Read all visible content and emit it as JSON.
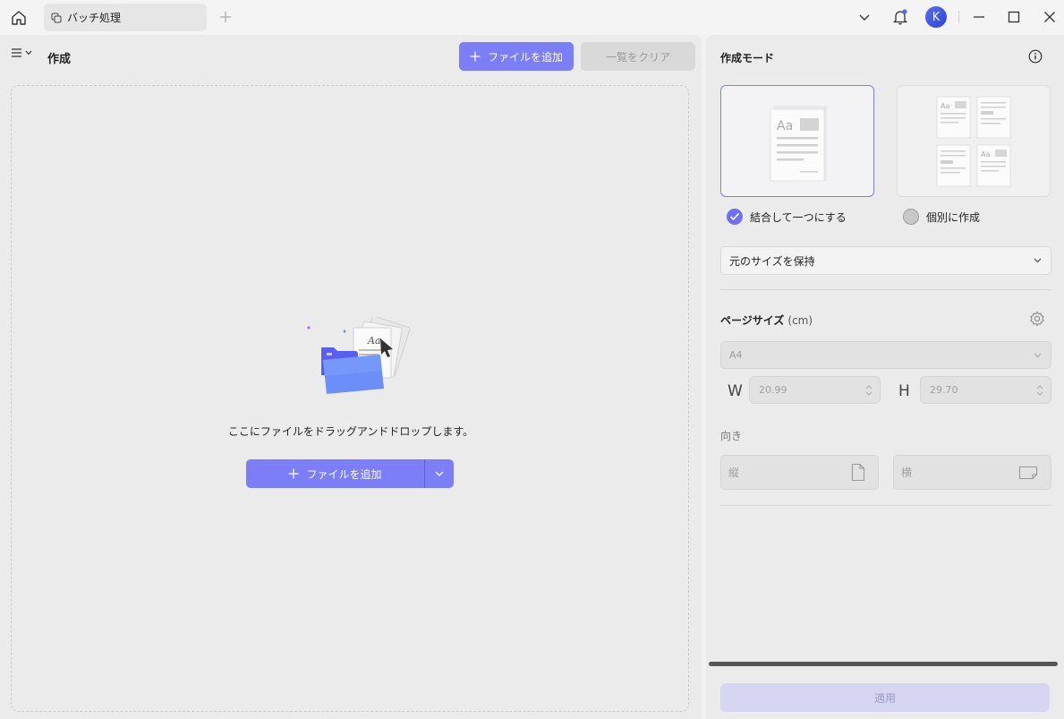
{
  "titlebar": {
    "tab_label": "バッチ処理",
    "avatar_letter": "K"
  },
  "left": {
    "title": "作成",
    "add_file_label": "ファイルを追加",
    "clear_list_label": "一覧をクリア",
    "drop_text": "ここにファイルをドラッグアンドドロップします。",
    "add_file_main_label": "ファイルを追加"
  },
  "right": {
    "title": "作成モード",
    "mode_combine_label": "結合して一つにする",
    "mode_individual_label": "個別に作成",
    "mode_selected": "combine",
    "size_option": "元のサイズを保持",
    "page_size_label": "ページサイズ",
    "page_size_unit": "(cm)",
    "paper_option": "A4",
    "width_letter": "W",
    "width_value": "20.99",
    "height_letter": "H",
    "height_value": "29.70",
    "orientation_label": "向き",
    "portrait_label": "縦",
    "landscape_label": "横",
    "apply_label": "適用"
  },
  "colors": {
    "accent": "#7b7ef7",
    "apply_disabled": "#d6d6f2"
  }
}
